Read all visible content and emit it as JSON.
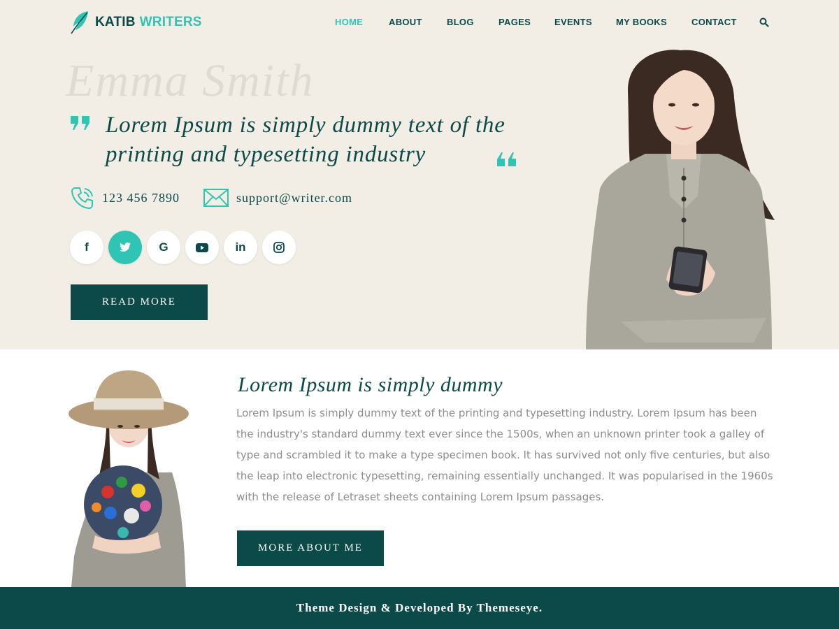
{
  "brand": {
    "name_part1": "KATIB",
    "name_part2": "WRITERS",
    "icon": "feather-icon"
  },
  "nav": {
    "items": [
      {
        "label": "HOME",
        "active": true
      },
      {
        "label": "ABOUT",
        "active": false
      },
      {
        "label": "BLOG",
        "active": false
      },
      {
        "label": "PAGES",
        "active": false
      },
      {
        "label": "EVENTS",
        "active": false
      },
      {
        "label": "MY BOOKS",
        "active": false
      },
      {
        "label": "CONTACT",
        "active": false
      }
    ],
    "search_icon": "search-icon"
  },
  "hero": {
    "name": "Emma Smith",
    "quote": "Lorem Ipsum is simply dummy text of the printing and typesetting industry",
    "phone": "123 456 7890",
    "email": "support@writer.com",
    "socials": [
      {
        "icon": "facebook-icon",
        "glyph": "f",
        "active": false
      },
      {
        "icon": "twitter-icon",
        "glyph": "t",
        "active": true
      },
      {
        "icon": "google-icon",
        "glyph": "G",
        "active": false
      },
      {
        "icon": "youtube-icon",
        "glyph": "▶",
        "active": false
      },
      {
        "icon": "linkedin-icon",
        "glyph": "in",
        "active": false
      },
      {
        "icon": "instagram-icon",
        "glyph": "◎",
        "active": false
      }
    ],
    "button_label": "READ MORE"
  },
  "about": {
    "title": "Lorem Ipsum is simply dummy",
    "body": "Lorem Ipsum is simply dummy text of the printing and typesetting industry. Lorem Ipsum has been the industry's standard dummy text ever since the 1500s, when an unknown printer took a galley of type and scrambled it to make a type specimen book. It has survived not only five centuries, but also the leap into electronic typesetting, remaining essentially unchanged. It was popularised in the 1960s with the release of Letraset sheets containing Lorem Ipsum passages.",
    "button_label": "MORE ABOUT ME"
  },
  "footer": {
    "text": "Theme Design & Developed By Themeseye."
  },
  "colors": {
    "primary": "#0b4a48",
    "accent": "#30c4b5",
    "hero_bg": "#f2eee6",
    "body_text": "#8d8d8d",
    "ghost_text": "#e0dbd2"
  }
}
